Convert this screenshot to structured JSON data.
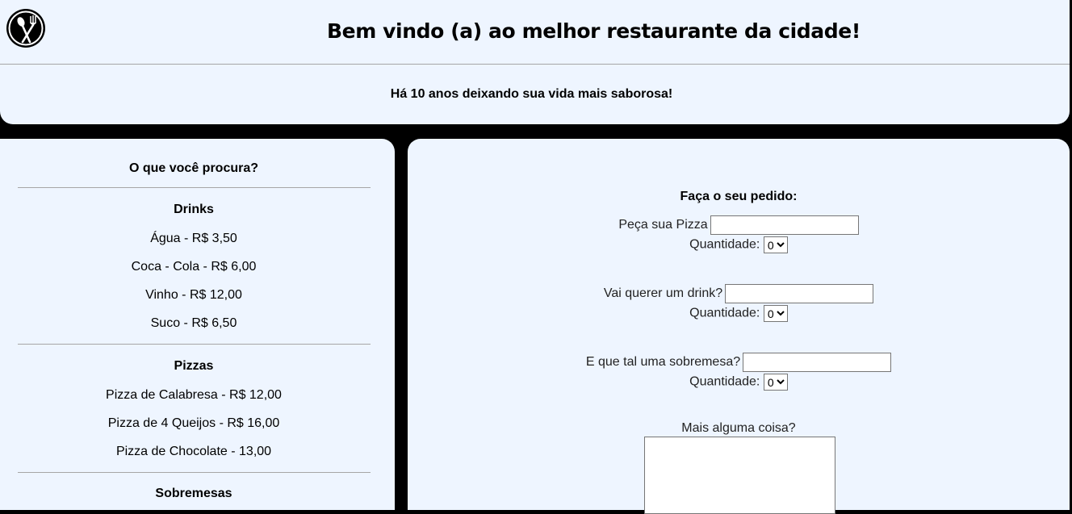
{
  "header": {
    "title": "Bem vindo (a) ao melhor restaurante da cidade!",
    "subtitle": "Há 10 anos deixando sua vida mais saborosa!",
    "logo_icon": "spoon-fork-logo-icon"
  },
  "sidebar": {
    "heading": "O que você procura?",
    "drinks_heading": "Drinks",
    "drinks": [
      "Água - R$ 3,50",
      "Coca - Cola - R$ 6,00",
      "Vinho - R$ 12,00",
      "Suco - R$ 6,50"
    ],
    "pizzas_heading": "Pizzas",
    "pizzas": [
      "Pizza de Calabresa - R$ 12,00",
      "Pizza de 4 Queijos - R$ 16,00",
      "Pizza de Chocolate - 13,00"
    ],
    "desserts_heading": "Sobremesas"
  },
  "order": {
    "title": "Faça o seu pedido:",
    "pizza_label": "Peça sua Pizza",
    "pizza_value": "",
    "drink_label": "Vai querer um drink?",
    "drink_value": "",
    "dessert_label": "E que tal uma sobremesa?",
    "dessert_value": "",
    "quantity_label": "Quantidade:",
    "quantity_selected": "0",
    "extra_label": "Mais alguma coisa?",
    "extra_value": ""
  },
  "colors": {
    "panel": "#eef5ff",
    "background": "#000000",
    "divider": "#a6a6a6"
  }
}
